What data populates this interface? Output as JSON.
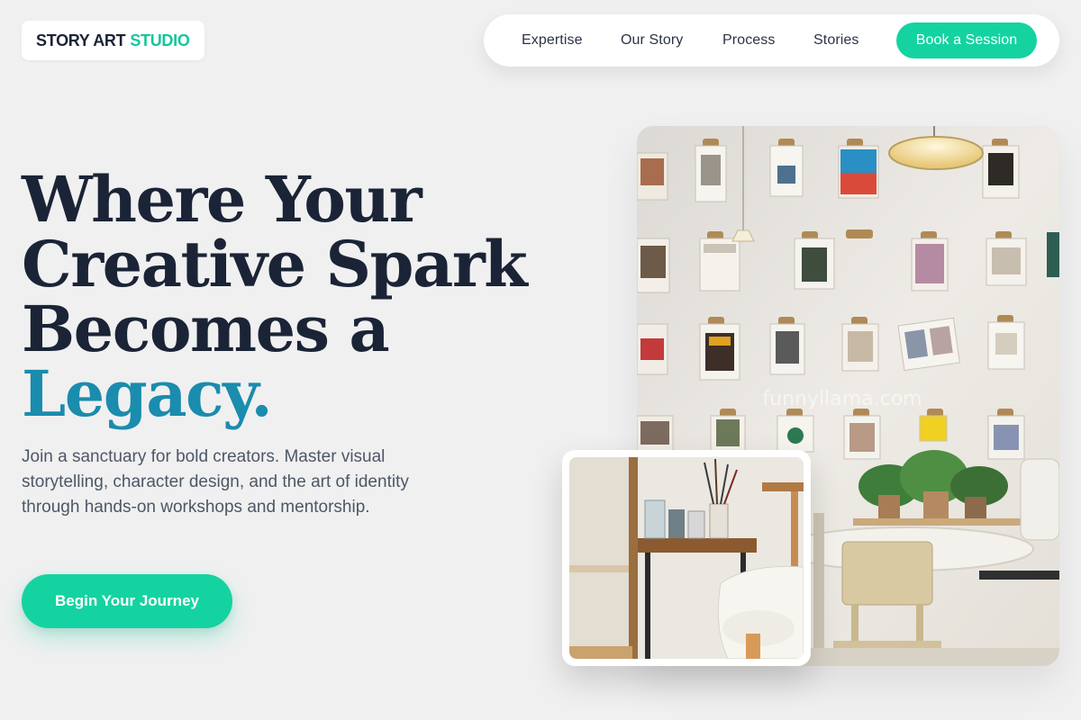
{
  "brand": {
    "name_part1": "STORY ART",
    "name_part2": "STUDIO"
  },
  "nav": {
    "links": [
      "Expertise",
      "Our Story",
      "Process",
      "Stories"
    ],
    "cta_label": "Book a Session"
  },
  "hero": {
    "headline_line1": "Where Your",
    "headline_line2": "Creative Spark",
    "headline_line3": "Becomes a",
    "headline_accent": "Legacy.",
    "description": "Join a sanctuary for bold creators. Master visual storytelling, character design, and the art of identity through hands-on workshops and mentorship.",
    "cta_label": "Begin Your Journey"
  },
  "images": {
    "main_watermark": "funnyllama.com"
  },
  "colors": {
    "accent_green": "#14d3a1",
    "accent_teal": "#1a8cad",
    "headline_navy": "#1b2436",
    "background": "#f0f0f1"
  }
}
